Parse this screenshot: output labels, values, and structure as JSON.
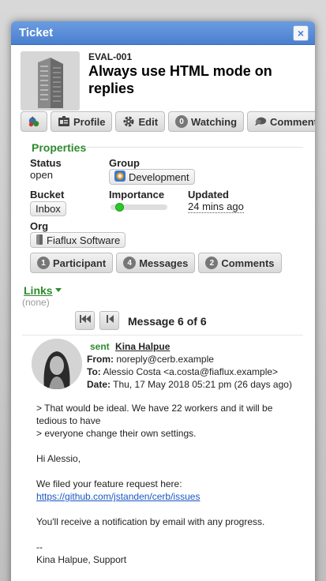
{
  "dialog": {
    "title": "Ticket",
    "close_icon": "×"
  },
  "ticket": {
    "mask": "EVAL-001",
    "subject": "Always use HTML mode on replies"
  },
  "toolbar": {
    "profile": "Profile",
    "edit": "Edit",
    "watching_count": "0",
    "watching": "Watching",
    "comment": "Comment"
  },
  "properties": {
    "title": "Properties",
    "status_label": "Status",
    "status_value": "open",
    "group_label": "Group",
    "group_value": "Development",
    "bucket_label": "Bucket",
    "bucket_value": "Inbox",
    "importance_label": "Importance",
    "importance_level": 0.1,
    "updated_label": "Updated",
    "updated_value": "24 mins ago",
    "org_label": "Org",
    "org_value": "Fiaflux Software"
  },
  "counts": {
    "participants_n": "1",
    "participants": "Participant",
    "messages_n": "4",
    "messages": "Messages",
    "comments_n": "2",
    "comments": "Comments"
  },
  "links": {
    "title": "Links",
    "empty": "(none)"
  },
  "message_nav": {
    "label": "Message 6 of 6"
  },
  "message": {
    "status": "sent",
    "sender": "Kina Halpue",
    "from_label": "From:",
    "from": "noreply@cerb.example",
    "to_label": "To:",
    "to": "Alessio Costa <a.costa@fiaflux.example>",
    "date_label": "Date:",
    "date": "Thu, 17 May 2018 05:21 pm (26 days ago)",
    "body": {
      "quote_1": "> That would be ideal. We have 22 workers and it will be",
      "quote_2": "tedious to have",
      "quote_3": "> everyone change their own settings.",
      "greeting": "Hi Alessio,",
      "line_1": "We filed your feature request here:",
      "link": "https://github.com/jstanden/cerb/issues",
      "line_2": "You'll receive a notification by email with any progress.",
      "sig_sep": "--",
      "signature": "Kina Halpue, Support"
    }
  },
  "colors": {
    "titlebar": "#4a7fd0",
    "section": "#2e8b2e",
    "link": "#1a56c4",
    "importance": "#28c828"
  }
}
